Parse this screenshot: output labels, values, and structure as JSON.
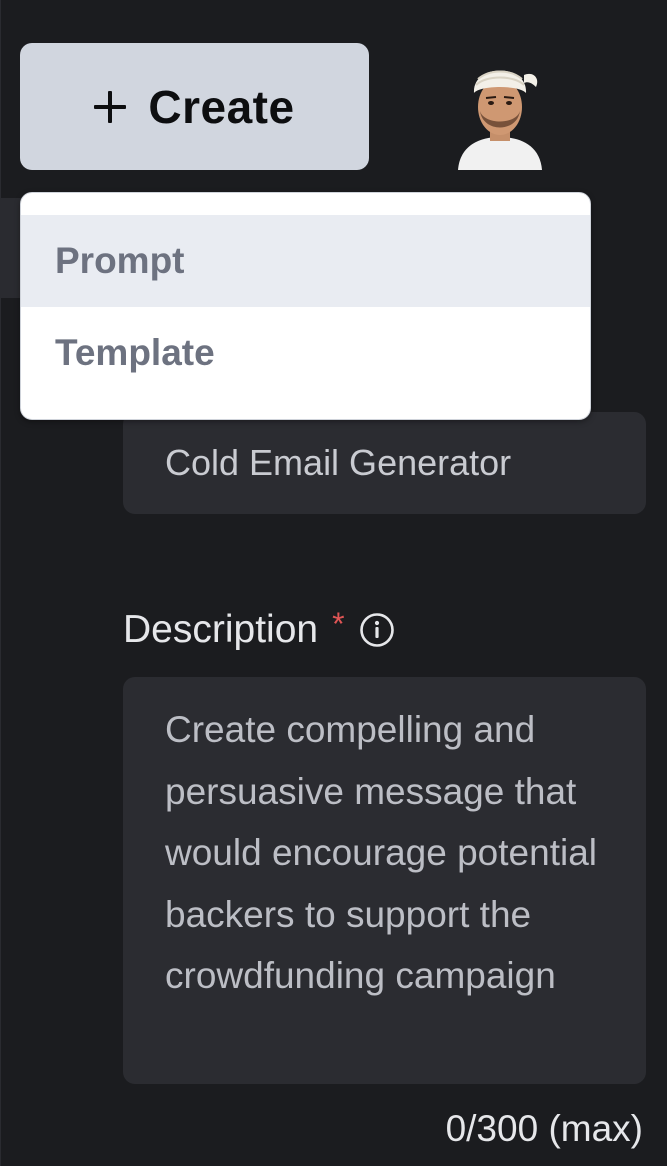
{
  "header": {
    "create_label": "Create"
  },
  "menu": {
    "items": [
      {
        "label": "Prompt",
        "highlighted": true
      },
      {
        "label": "Template",
        "highlighted": false
      }
    ]
  },
  "form": {
    "title_value": "Cold Email Generator",
    "description_label": "Description",
    "required_marker": "*",
    "description_value": "Create compelling and persuasive message that would encourage potential backers to support the crowdfunding campaign",
    "char_counter": "0/300 (max)"
  },
  "colors": {
    "background": "#1b1c1f",
    "field_bg": "#2b2c31",
    "create_button_bg": "#d1d6df",
    "menu_highlight": "#e9ecf2",
    "required_star": "#e05555"
  },
  "icons": {
    "create": "plus-icon",
    "description_info": "info-icon",
    "profile": "avatar"
  }
}
